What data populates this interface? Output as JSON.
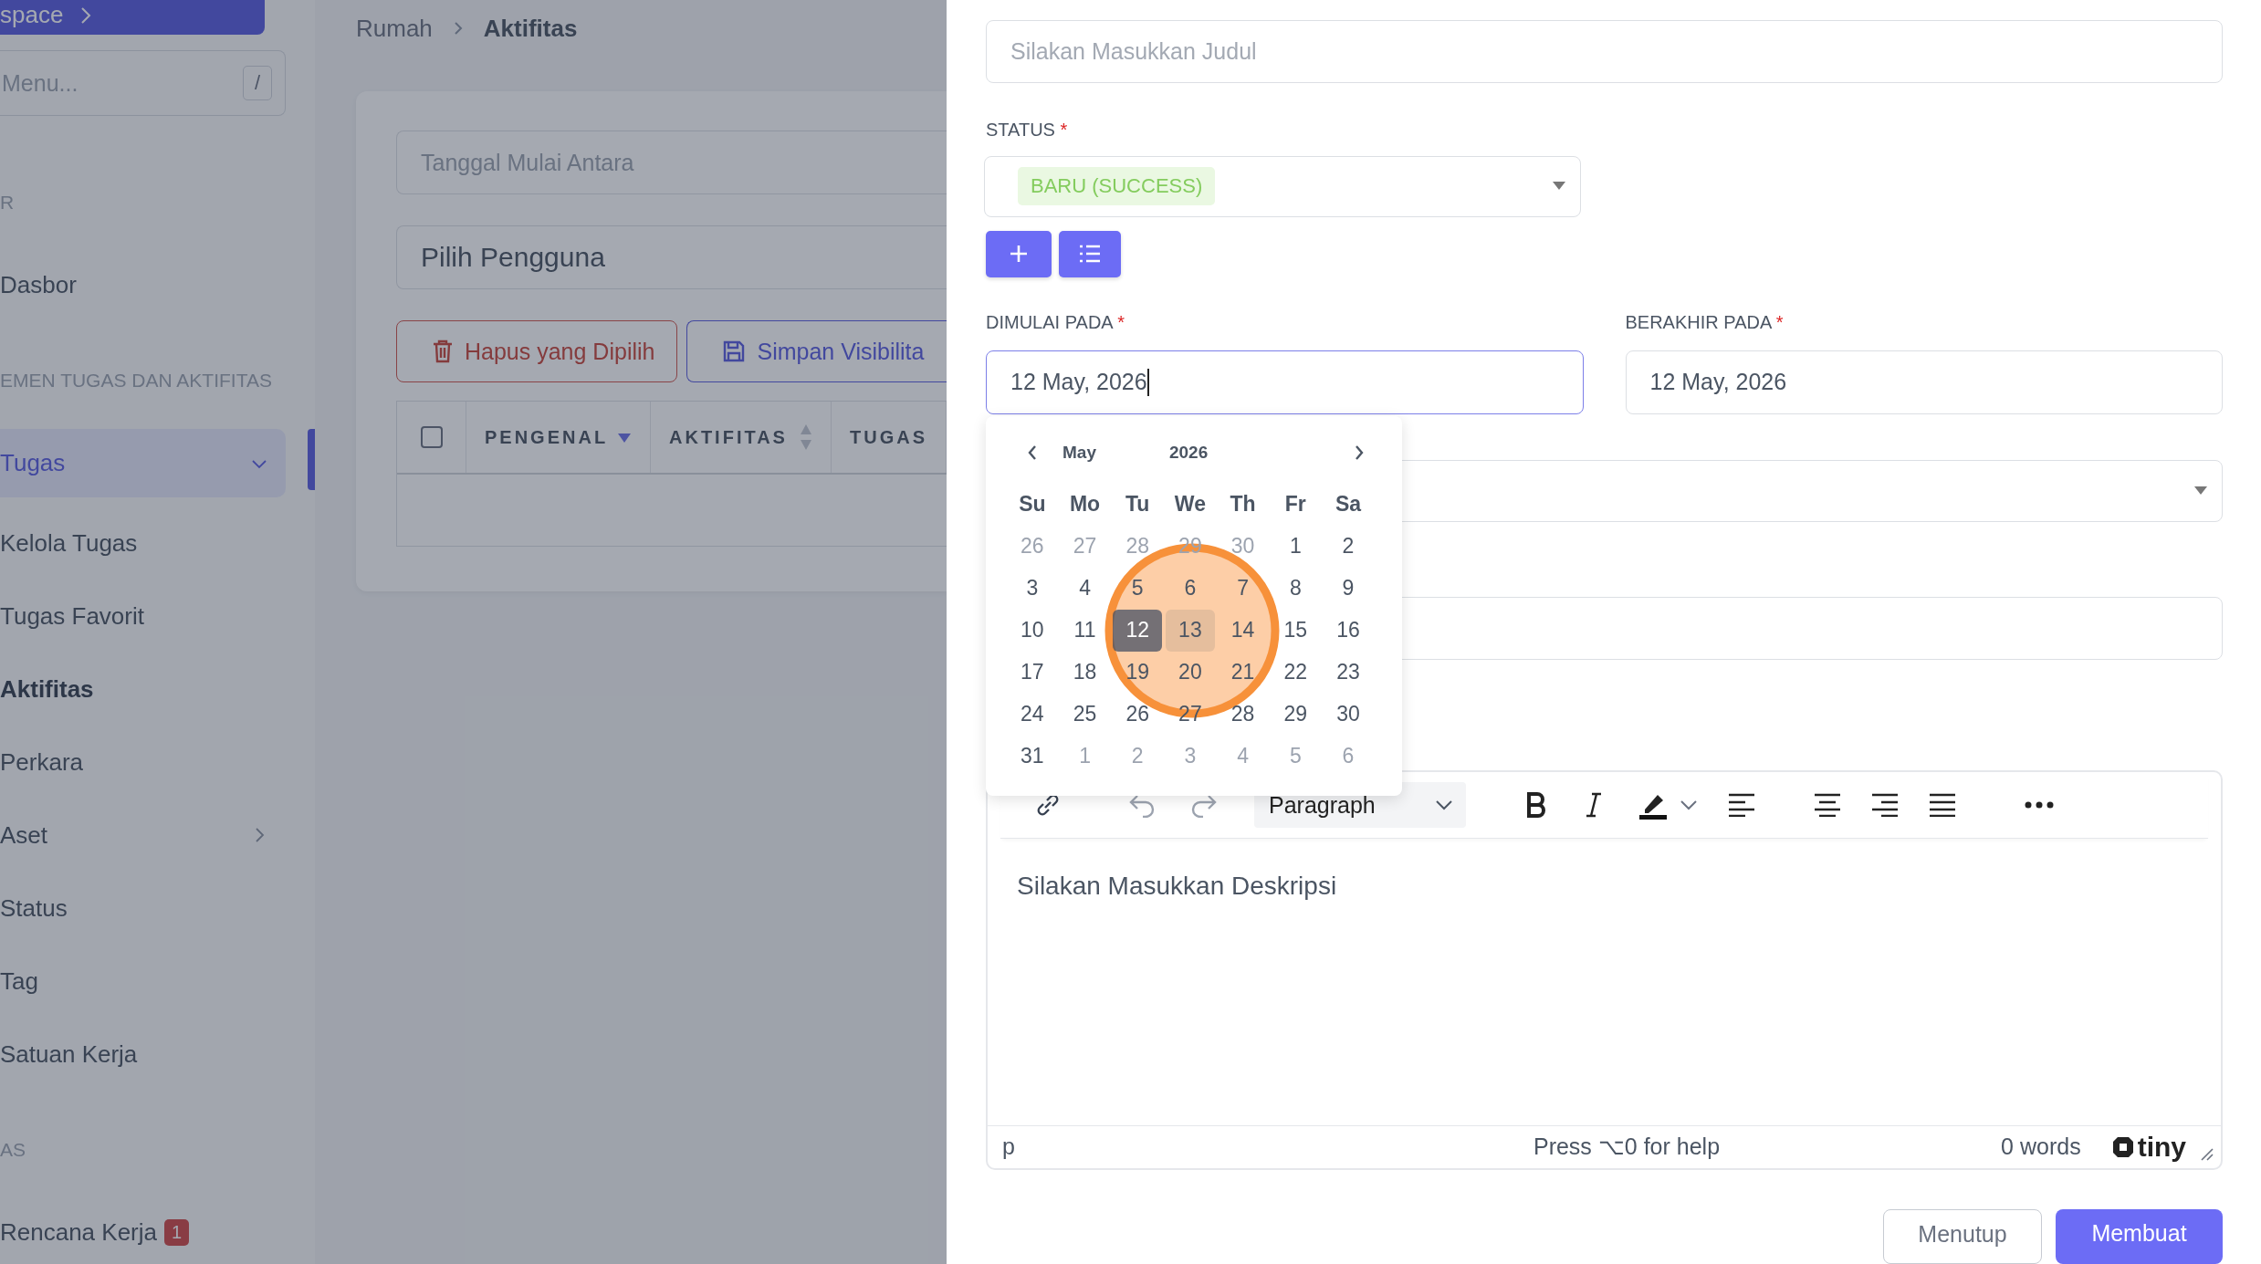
{
  "sidebar": {
    "workspace_button": "space",
    "search": {
      "placeholder": "Menu...",
      "shortcut": "/"
    },
    "items": [
      {
        "kind": "section",
        "label": "R"
      },
      {
        "kind": "link",
        "label": "Dasbor",
        "selected": false,
        "current": false
      },
      {
        "kind": "section",
        "label": "EMEN TUGAS DAN AKTIFITAS"
      },
      {
        "kind": "link",
        "label": "Tugas",
        "selected": true,
        "current": false,
        "expanded": true
      },
      {
        "kind": "link",
        "label": "Kelola Tugas",
        "selected": false,
        "current": false
      },
      {
        "kind": "link",
        "label": "Tugas Favorit",
        "selected": false,
        "current": false
      },
      {
        "kind": "link",
        "label": "Aktifitas",
        "selected": false,
        "current": true
      },
      {
        "kind": "link",
        "label": "Perkara",
        "selected": false,
        "current": false
      },
      {
        "kind": "link",
        "label": "Aset",
        "selected": false,
        "current": false,
        "expanded": false
      },
      {
        "kind": "link",
        "label": "Status",
        "selected": false,
        "current": false
      },
      {
        "kind": "link",
        "label": "Tag",
        "selected": false,
        "current": false
      },
      {
        "kind": "link",
        "label": "Satuan Kerja",
        "selected": false,
        "current": false
      },
      {
        "kind": "section",
        "label": "AS"
      },
      {
        "kind": "link",
        "label": "Rencana Kerja",
        "selected": false,
        "current": false,
        "badge": "1"
      }
    ]
  },
  "breadcrumb": [
    "Rumah",
    "Aktifitas"
  ],
  "filters": [
    {
      "kind": "date",
      "placeholder": "Tanggal Mulai Antara"
    },
    {
      "kind": "select",
      "placeholder": "Pilih Pengguna"
    }
  ],
  "actions": [
    {
      "kind": "danger",
      "label": "Hapus yang Dipilih"
    },
    {
      "kind": "primary",
      "label": "Simpan Visibilita"
    }
  ],
  "table": {
    "select_all": {
      "checked": false
    },
    "columns": [
      {
        "label": "PENGENAL",
        "sorted": true
      },
      {
        "label": "AKTIFITAS",
        "sorted": false
      },
      {
        "label": "TUGAS"
      }
    ]
  },
  "form": {
    "title_field": {
      "placeholder": "Silakan Masukkan Judul"
    },
    "status": {
      "label": "STATUS",
      "required_mark": "*",
      "value": "BARU (SUCCESS)"
    },
    "dates": [
      {
        "label": "DIMULAI PADA",
        "required_mark": "*",
        "value": "12 May, 2026",
        "focused": true
      },
      {
        "label": "BERAKHIR PADA",
        "required_mark": "*",
        "value": "12 May, 2026",
        "focused": false
      }
    ],
    "calendar": {
      "month": "May",
      "year": "2026",
      "weekdays": [
        "Su",
        "Mo",
        "Tu",
        "We",
        "Th",
        "Fr",
        "Sa"
      ],
      "days": [
        {
          "label": "26",
          "outside": true,
          "selected": false,
          "hovered": false
        },
        {
          "label": "27",
          "outside": true,
          "selected": false,
          "hovered": false
        },
        {
          "label": "28",
          "outside": true,
          "selected": false,
          "hovered": false
        },
        {
          "label": "29",
          "outside": true,
          "selected": false,
          "hovered": false
        },
        {
          "label": "30",
          "outside": true,
          "selected": false,
          "hovered": false
        },
        {
          "label": "1",
          "outside": false,
          "selected": false,
          "hovered": false
        },
        {
          "label": "2",
          "outside": false,
          "selected": false,
          "hovered": false
        },
        {
          "label": "3",
          "outside": false,
          "selected": false,
          "hovered": false
        },
        {
          "label": "4",
          "outside": false,
          "selected": false,
          "hovered": false
        },
        {
          "label": "5",
          "outside": false,
          "selected": false,
          "hovered": false
        },
        {
          "label": "6",
          "outside": false,
          "selected": false,
          "hovered": false
        },
        {
          "label": "7",
          "outside": false,
          "selected": false,
          "hovered": false
        },
        {
          "label": "8",
          "outside": false,
          "selected": false,
          "hovered": false
        },
        {
          "label": "9",
          "outside": false,
          "selected": false,
          "hovered": false
        },
        {
          "label": "10",
          "outside": false,
          "selected": false,
          "hovered": false
        },
        {
          "label": "11",
          "outside": false,
          "selected": false,
          "hovered": false
        },
        {
          "label": "12",
          "outside": false,
          "selected": true,
          "hovered": false
        },
        {
          "label": "13",
          "outside": false,
          "selected": false,
          "hovered": true
        },
        {
          "label": "14",
          "outside": false,
          "selected": false,
          "hovered": false
        },
        {
          "label": "15",
          "outside": false,
          "selected": false,
          "hovered": false
        },
        {
          "label": "16",
          "outside": false,
          "selected": false,
          "hovered": false
        },
        {
          "label": "17",
          "outside": false,
          "selected": false,
          "hovered": false
        },
        {
          "label": "18",
          "outside": false,
          "selected": false,
          "hovered": false
        },
        {
          "label": "19",
          "outside": false,
          "selected": false,
          "hovered": false
        },
        {
          "label": "20",
          "outside": false,
          "selected": false,
          "hovered": false
        },
        {
          "label": "21",
          "outside": false,
          "selected": false,
          "hovered": false
        },
        {
          "label": "22",
          "outside": false,
          "selected": false,
          "hovered": false
        },
        {
          "label": "23",
          "outside": false,
          "selected": false,
          "hovered": false
        },
        {
          "label": "24",
          "outside": false,
          "selected": false,
          "hovered": false
        },
        {
          "label": "25",
          "outside": false,
          "selected": false,
          "hovered": false
        },
        {
          "label": "26",
          "outside": false,
          "selected": false,
          "hovered": false
        },
        {
          "label": "27",
          "outside": false,
          "selected": false,
          "hovered": false
        },
        {
          "label": "28",
          "outside": false,
          "selected": false,
          "hovered": false
        },
        {
          "label": "29",
          "outside": false,
          "selected": false,
          "hovered": false
        },
        {
          "label": "30",
          "outside": false,
          "selected": false,
          "hovered": false
        },
        {
          "label": "31",
          "outside": false,
          "selected": false,
          "hovered": false
        },
        {
          "label": "1",
          "outside": true,
          "selected": false,
          "hovered": false
        },
        {
          "label": "2",
          "outside": true,
          "selected": false,
          "hovered": false
        },
        {
          "label": "3",
          "outside": true,
          "selected": false,
          "hovered": false
        },
        {
          "label": "4",
          "outside": true,
          "selected": false,
          "hovered": false
        },
        {
          "label": "5",
          "outside": true,
          "selected": false,
          "hovered": false
        },
        {
          "label": "6",
          "outside": true,
          "selected": false,
          "hovered": false
        }
      ]
    },
    "editor": {
      "block_format": "Paragraph",
      "placeholder": "Silakan Masukkan Deskripsi",
      "path": "p",
      "help": "Press ⌥0 for help",
      "word_count": "0 words",
      "brand": "tiny"
    },
    "buttons": [
      {
        "kind": "secondary",
        "label": "Menutup"
      },
      {
        "kind": "primary",
        "label": "Membuat"
      }
    ]
  }
}
